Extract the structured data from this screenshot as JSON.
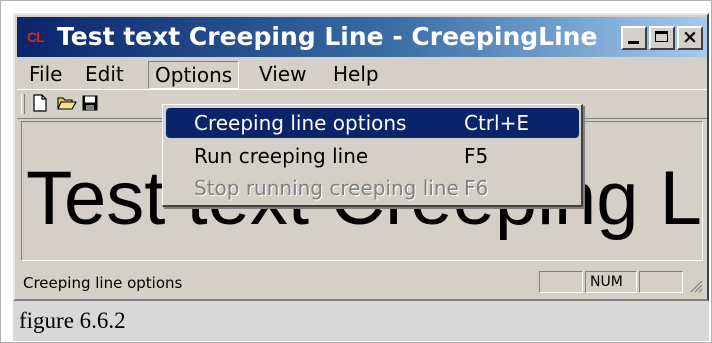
{
  "window": {
    "title": "Test text Creeping Line - CreepingLine",
    "icon": "CL"
  },
  "menubar": {
    "items": [
      "File",
      "Edit",
      "Options",
      "View",
      "Help"
    ]
  },
  "toolbar": {
    "icons": [
      "new-document-icon",
      "open-folder-icon",
      "save-disk-icon"
    ]
  },
  "dropdown": {
    "items": [
      {
        "label": "Creeping line options",
        "shortcut": "Ctrl+E"
      },
      {
        "label": "Run creeping line",
        "shortcut": "F5"
      },
      {
        "label": "Stop running creeping line",
        "shortcut": "F6"
      }
    ]
  },
  "client": {
    "text": "Test text Creeping Line"
  },
  "statusbar": {
    "text": "Creeping line options",
    "panes": [
      "",
      "NUM",
      ""
    ]
  },
  "caption": "figure 6.6.2",
  "colors": {
    "title_start": "#0a246a",
    "title_end": "#a6caf0",
    "highlight": "#0a246a",
    "face": "#d4d0c8",
    "caption_bg": "#d8d8d8"
  }
}
